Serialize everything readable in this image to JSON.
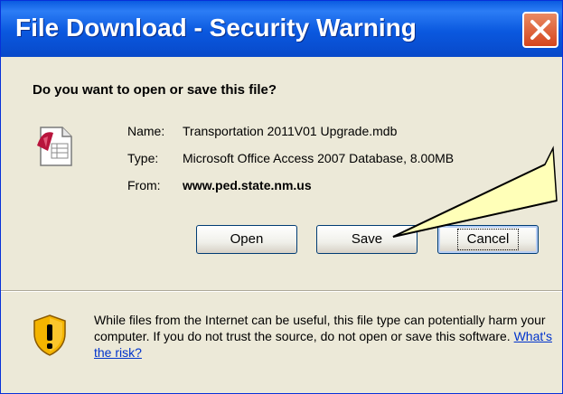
{
  "window": {
    "title": "File Download - Security Warning"
  },
  "dialog": {
    "question": "Do you want to open or save this file?",
    "file": {
      "name_label": "Name:",
      "name_value": "Transportation 2011V01 Upgrade.mdb",
      "type_label": "Type:",
      "type_value": "Microsoft Office Access 2007 Database, 8.00MB",
      "from_label": "From:",
      "from_value": "www.ped.state.nm.us"
    },
    "buttons": {
      "open": "Open",
      "save": "Save",
      "cancel": "Cancel"
    },
    "warning": {
      "text": "While files from the Internet can be useful, this file type can potentially harm your computer. If you do not trust the source, do not open or save this software. ",
      "link": "What's the risk?"
    }
  },
  "colors": {
    "titlebar": "#0a58df",
    "dialog_bg": "#ece9d8",
    "callout_fill": "#ffffb8"
  }
}
